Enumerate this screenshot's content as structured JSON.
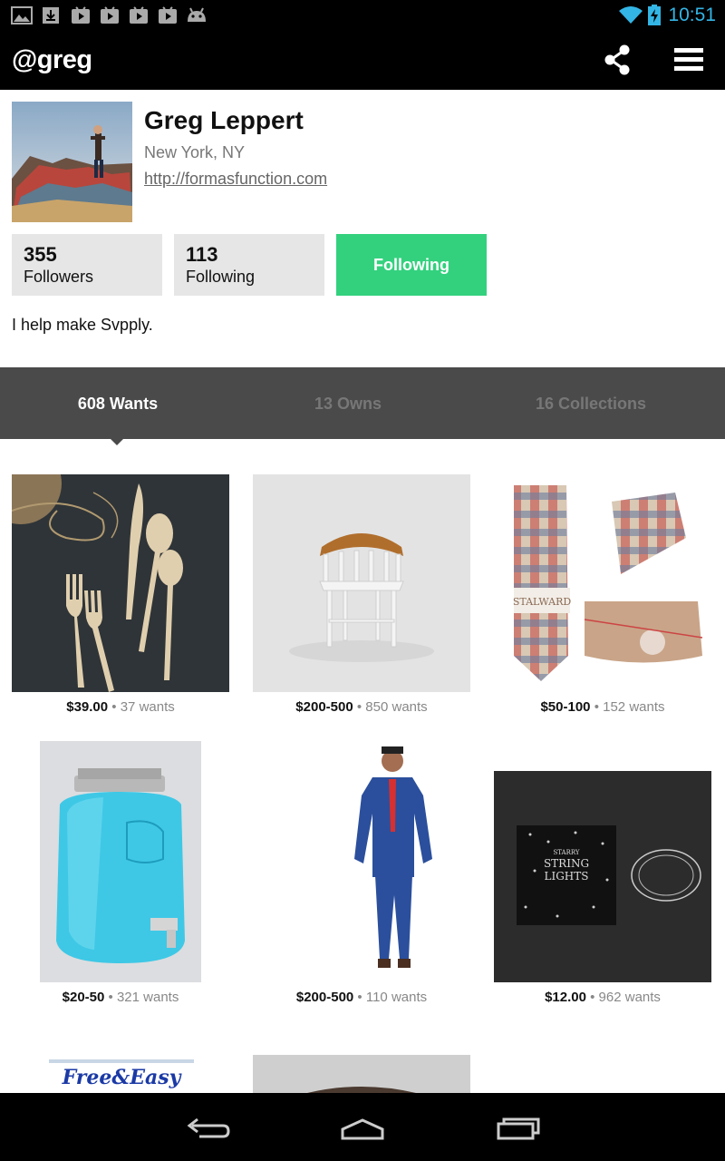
{
  "status_bar": {
    "time": "10:51",
    "left_icons": [
      "image-icon",
      "download-icon",
      "play-store-icon",
      "play-store-icon",
      "play-store-icon",
      "play-store-icon",
      "android-icon"
    ],
    "right_icons": [
      "wifi-icon",
      "battery-charging-icon"
    ],
    "accent": "#33b5e5"
  },
  "action_bar": {
    "title": "@greg",
    "actions": [
      "share-icon",
      "menu-icon"
    ]
  },
  "profile": {
    "name": "Greg Leppert",
    "location": "New York, NY",
    "website": "http://formasfunction.com",
    "followers_count": "355",
    "followers_label": "Followers",
    "following_count": "113",
    "following_label": "Following",
    "follow_button": "Following",
    "follow_color": "#33d17e",
    "bio": "I help make Svpply."
  },
  "tabs": [
    {
      "label": "608 Wants",
      "active": true
    },
    {
      "label": "13 Owns",
      "active": false
    },
    {
      "label": "16 Collections",
      "active": false
    }
  ],
  "products": [
    {
      "price": "$39.00",
      "wants": "37 wants"
    },
    {
      "price": "$200-500",
      "wants": "850 wants"
    },
    {
      "price": "$50-100",
      "wants": "152 wants"
    },
    {
      "price": "$20-50",
      "wants": "321 wants"
    },
    {
      "price": "$200-500",
      "wants": "110 wants"
    },
    {
      "price": "$12.00",
      "wants": "962 wants"
    }
  ],
  "partial_products": [
    {
      "logo_text": "Free&Easy"
    }
  ],
  "product_image_text": {
    "tie_brand": "STALWARD",
    "lights_box": [
      "STARRY",
      "STRING",
      "LIGHTS"
    ]
  },
  "nav_bar": [
    "back-icon",
    "home-icon",
    "recents-icon"
  ]
}
